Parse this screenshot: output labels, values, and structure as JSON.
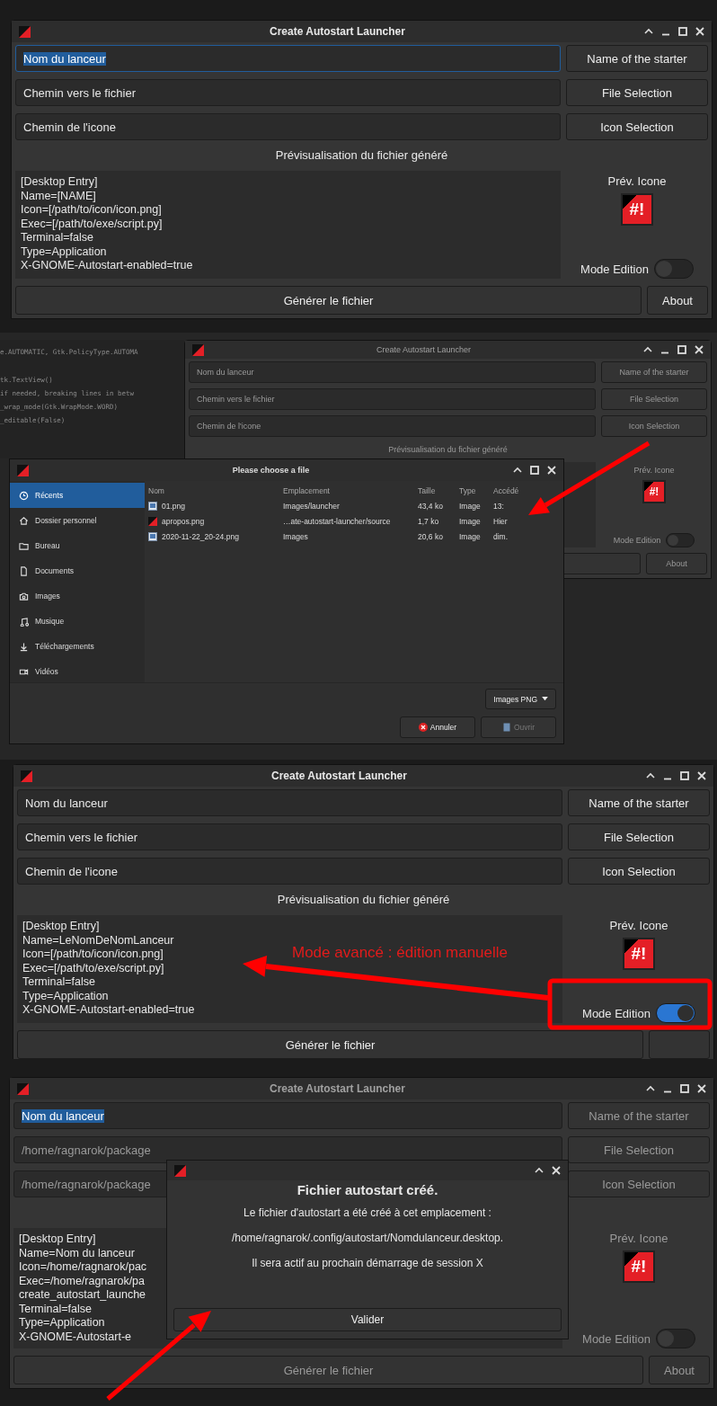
{
  "panels": [
    {
      "kind": "main",
      "window": {
        "title": "Create Autostart Launcher",
        "active": true,
        "fields": [
          {
            "value": "Nom du lanceur",
            "text_selected": true
          },
          {
            "value": "Chemin vers le fichier",
            "text_selected": false
          },
          {
            "value": "Chemin de l'icone",
            "text_selected": false
          }
        ],
        "buttons": [
          "Name of the starter",
          "File Selection",
          "Icon Selection"
        ],
        "preview_label": "Prévisualisation du fichier généré",
        "preview_lines": [
          "[Desktop Entry]",
          "Name=[NAME]",
          "Icon=[/path/to/icon/icon.png]",
          "Exec=[/path/to/exe/script.py]",
          "Terminal=false",
          "Type=Application",
          "X-GNOME-Autostart-enabled=true"
        ],
        "icon_label": "Prév. Icone",
        "icon_glyph": "#!",
        "mode_label": "Mode Edition",
        "edit_mode": false,
        "generate": "Générer le fichier",
        "about": "About"
      }
    },
    {
      "kind": "file_chooser",
      "code_lines": [
        "e.AUTOMATIC, Gtk.PolicyType.AUTOMA",
        "tk.TextView()",
        "if needed, breaking lines in betw",
        "_wrap_mode(Gtk.WrapMode.WORD)",
        "_editable(False)"
      ],
      "window": {
        "title": "Create Autostart Launcher",
        "active": false,
        "fields": [
          {
            "value": "Nom du lanceur",
            "text_selected": false
          },
          {
            "value": "Chemin vers le fichier",
            "text_selected": false
          },
          {
            "value": "Chemin de l'icone",
            "text_selected": false
          }
        ],
        "buttons": [
          "Name of the starter",
          "File Selection",
          "Icon Selection"
        ],
        "preview_label": "Prévisualisation du fichier généré",
        "icon_label": "Prév. Icone",
        "icon_glyph": "#!",
        "mode_label": "Mode Edition",
        "edit_mode": false,
        "about": "About"
      },
      "chooser": {
        "title": "Please choose a file",
        "places": [
          {
            "label": "Récents",
            "selected": true
          },
          {
            "label": "Dossier personnel",
            "selected": false
          },
          {
            "label": "Bureau",
            "selected": false
          },
          {
            "label": "Documents",
            "selected": false
          },
          {
            "label": "Images",
            "selected": false
          },
          {
            "label": "Musique",
            "selected": false
          },
          {
            "label": "Téléchargements",
            "selected": false
          },
          {
            "label": "Vidéos",
            "selected": false
          }
        ],
        "columns": [
          "Nom",
          "Emplacement",
          "Taille",
          "Type",
          "Accédé"
        ],
        "rows": [
          {
            "kind": "image",
            "name": "01.png",
            "location": "Images/launcher",
            "size": "43,4 ko",
            "type": "Image",
            "accessed": "13:"
          },
          {
            "kind": "app",
            "name": "apropos.png",
            "location": "…ate-autostart-launcher/source",
            "size": "1,7 ko",
            "type": "Image",
            "accessed": "Hier"
          },
          {
            "kind": "image",
            "name": "2020-11-22_20-24.png",
            "location": "Images",
            "size": "20,6 ko",
            "type": "Image",
            "accessed": "dim."
          }
        ],
        "filter": "Images PNG",
        "actions": [
          {
            "label": "Annuler",
            "disabled": false
          },
          {
            "label": "Ouvrir",
            "disabled": true
          }
        ]
      }
    },
    {
      "kind": "annotated",
      "window": {
        "title": "Create Autostart Launcher",
        "active": true,
        "fields": [
          {
            "value": "Nom du lanceur",
            "text_selected": false
          },
          {
            "value": "Chemin vers le fichier",
            "text_selected": false
          },
          {
            "value": "Chemin de l'icone",
            "text_selected": false
          }
        ],
        "buttons": [
          "Name of the starter",
          "File Selection",
          "Icon Selection"
        ],
        "preview_label": "Prévisualisation du fichier généré",
        "preview_lines": [
          "[Desktop Entry]",
          "Name=LeNomDeNomLanceur",
          "Icon=[/path/to/icon/icon.png]",
          "Exec=[/path/to/exe/script.py]",
          "Terminal=false",
          "Type=Application",
          "X-GNOME-Autostart-enabled=true"
        ],
        "icon_label": "Prév. Icone",
        "icon_glyph": "#!",
        "mode_label": "Mode Edition",
        "edit_mode": true,
        "generate": "Générer le fichier"
      },
      "annotation": "Mode avancé : édition manuelle"
    },
    {
      "kind": "confirmation",
      "window": {
        "title": "Create Autostart Launcher",
        "active": false,
        "fields": [
          {
            "value": "Nom du lanceur",
            "text_selected": true
          },
          {
            "value": "/home/ragnarok/package",
            "text_selected": false
          },
          {
            "value": "/home/ragnarok/package",
            "text_selected": false
          }
        ],
        "buttons": [
          "Name of the starter",
          "File Selection",
          "Icon Selection"
        ],
        "preview_lines": [
          "[Desktop Entry]",
          "Name=Nom du lanceur",
          "Icon=/home/ragnarok/pac",
          "Exec=/home/ragnarok/pa",
          "create_autostart_launche",
          "Terminal=false",
          "Type=Application",
          "X-GNOME-Autostart-e"
        ],
        "icon_label": "Prév. Icone",
        "icon_glyph": "#!",
        "mode_label": "Mode Edition",
        "edit_mode": false,
        "generate": "Générer le fichier",
        "about": "About"
      },
      "dialog": {
        "title": "Fichier autostart créé.",
        "lines": [
          "Le fichier d'autostart a été créé à cet emplacement :",
          "/home/ragnarok/.config/autostart/Nomdulanceur.desktop.",
          "Il sera actif au prochain démarrage de session X"
        ],
        "button": "Valider"
      }
    }
  ]
}
